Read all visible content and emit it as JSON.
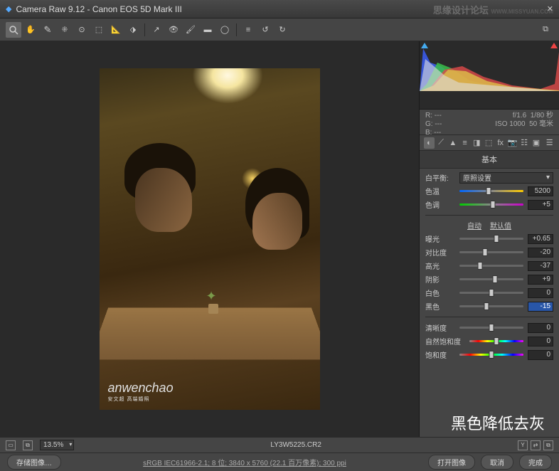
{
  "window": {
    "title": "Camera Raw 9.12  -  Canon EOS 5D Mark III"
  },
  "watermark_top": {
    "main": "思缘设计论坛",
    "sub": "WWW.MISSYUAN.COM"
  },
  "meta": {
    "r": "R:",
    "g": "G:",
    "b": "B:",
    "r_val": "---",
    "g_val": "---",
    "b_val": "---",
    "fstop": "f/1.6",
    "shutter": "1/80 秒",
    "iso": "ISO 1000",
    "focal": "50 毫米"
  },
  "panel": {
    "title": "基本"
  },
  "wb": {
    "label": "白平衡:",
    "value": "原照设置"
  },
  "sliders": {
    "temp": {
      "label": "色温",
      "value": "5200",
      "pos": 45
    },
    "tint": {
      "label": "色调",
      "value": "+5",
      "pos": 52
    },
    "exposure": {
      "label": "曝光",
      "value": "+0.65",
      "pos": 58
    },
    "contrast": {
      "label": "对比度",
      "value": "-20",
      "pos": 40
    },
    "highlights": {
      "label": "高光",
      "value": "-37",
      "pos": 32
    },
    "shadows": {
      "label": "阴影",
      "value": "+9",
      "pos": 55
    },
    "whites": {
      "label": "白色",
      "value": "0",
      "pos": 50
    },
    "blacks": {
      "label": "黑色",
      "value": "-15",
      "pos": 42
    },
    "clarity": {
      "label": "清晰度",
      "value": "0",
      "pos": 50
    },
    "vibrance": {
      "label": "自然饱和度",
      "value": "0",
      "pos": 50
    },
    "saturation": {
      "label": "饱和度",
      "value": "0",
      "pos": 50
    }
  },
  "auto": {
    "auto": "自动",
    "default": "默认值"
  },
  "annotation": "黑色降低去灰",
  "status": {
    "zoom": "13.5%",
    "filename": "LY3W5225.CR2"
  },
  "bottom": {
    "info": "sRGB IEC61966-2.1; 8 位; 3840 x 5760 (22.1 百万像素); 300 ppi",
    "save": "存储图像…",
    "open": "打开图像",
    "cancel": "取消",
    "done": "完成"
  },
  "photo_watermark": {
    "name": "anwenchao",
    "sub": "安文超 高端婚照"
  }
}
